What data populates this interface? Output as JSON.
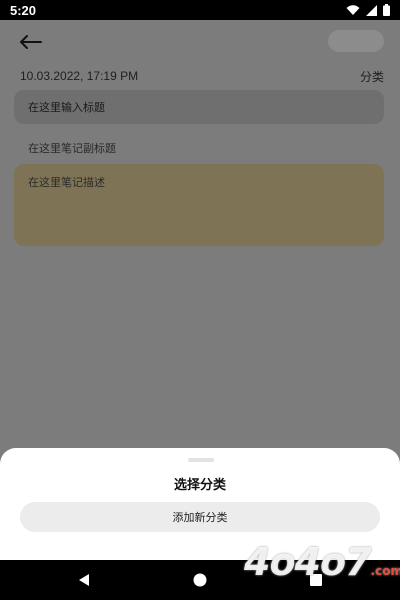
{
  "status_bar": {
    "time": "5:20"
  },
  "editor": {
    "date": "10.03.2022, 17:19 PM",
    "category_label": "分类",
    "title_placeholder": "在这里输入标题",
    "subtitle_placeholder": "在这里笔记副标题",
    "description_placeholder": "在这里笔记描述"
  },
  "sheet": {
    "title": "选择分类",
    "add_button_label": "添加新分类"
  },
  "watermark": {
    "text": "4o4o7",
    "suffix": ".com"
  },
  "colors": {
    "overlay": "#7c7c7c",
    "description_bg": "#7e7455",
    "sheet_bg": "#ffffff",
    "button_bg": "#ececec"
  }
}
